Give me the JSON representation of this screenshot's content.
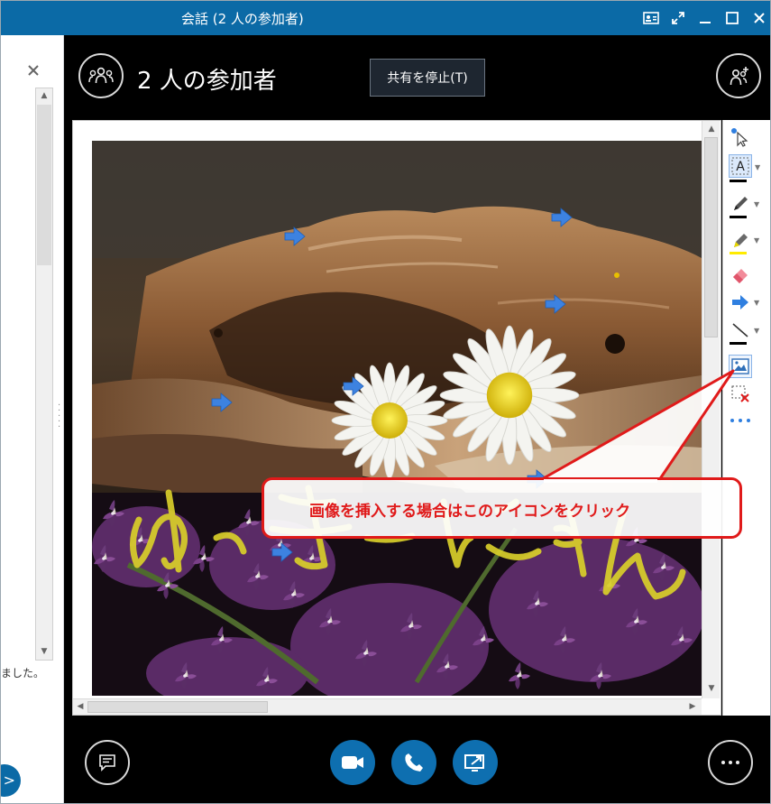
{
  "window": {
    "title": "会話 (2 人の参加者)"
  },
  "left_pane": {
    "message_snippet": "ました。"
  },
  "header": {
    "participants_title": "2 人の参加者",
    "stop_sharing_label": "共有を停止(T)"
  },
  "callout": {
    "text": "画像を挿入する場合はこのアイコンをクリック"
  },
  "toolbar": {
    "tools": [
      {
        "name": "pointer"
      },
      {
        "name": "text",
        "color": "#000000"
      },
      {
        "name": "pen",
        "color": "#000000"
      },
      {
        "name": "highlighter",
        "color": "#ffeb00"
      },
      {
        "name": "eraser"
      },
      {
        "name": "arrow-stamp",
        "color": "#2f7fe0"
      },
      {
        "name": "line",
        "color": "#000000"
      },
      {
        "name": "insert-image"
      },
      {
        "name": "delete-selected"
      },
      {
        "name": "more"
      }
    ]
  },
  "colors": {
    "title_bar": "#0b6aa6",
    "accent_blue": "#0e6fb0",
    "callout_red": "#e01a1a",
    "ink_yellow": "#d9cf2a",
    "arrow_blue": "#3d82e0"
  }
}
